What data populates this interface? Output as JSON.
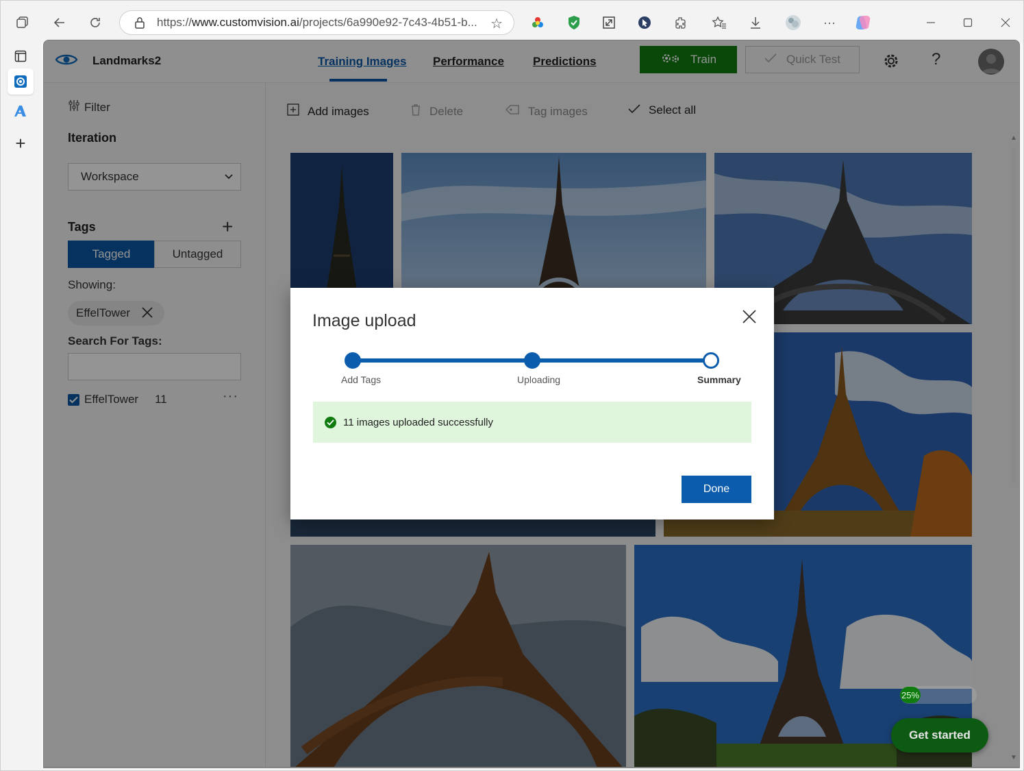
{
  "browser": {
    "url_prefix": "https://",
    "url_host": "www.customvision.ai",
    "url_rest": "/projects/6a990e92-7c43-4b51-b..."
  },
  "app": {
    "project_name": "Landmarks2",
    "tabs": [
      {
        "label": "Training Images",
        "active": true
      },
      {
        "label": "Performance",
        "active": false
      },
      {
        "label": "Predictions",
        "active": false
      }
    ],
    "train_label": "Train",
    "quick_test_label": "Quick Test",
    "help_label": "?"
  },
  "filter_panel": {
    "filter_label": "Filter",
    "iteration_label": "Iteration",
    "iteration_value": "Workspace",
    "tags_label": "Tags",
    "tagged_label": "Tagged",
    "untagged_label": "Untagged",
    "showing_label": "Showing:",
    "active_chip": "EffelTower",
    "search_label": "Search For Tags:",
    "search_value": "",
    "tag_list": [
      {
        "name": "EffelTower",
        "count": "11",
        "checked": true
      }
    ]
  },
  "toolbar": {
    "add_images": "Add images",
    "delete": "Delete",
    "tag_images": "Tag images",
    "select_all": "Select all"
  },
  "modal": {
    "title": "Image upload",
    "steps": [
      "Add Tags",
      "Uploading",
      "Summary"
    ],
    "current_step": "Summary",
    "message": "11 images uploaded successfully",
    "done_label": "Done"
  },
  "floating": {
    "progress_label": "25%",
    "progress": 0.25,
    "get_started_label": "Get started"
  },
  "colors": {
    "accent_blue": "#0b5cad",
    "train_green": "#107c10",
    "success_bg": "#dff6dd"
  }
}
